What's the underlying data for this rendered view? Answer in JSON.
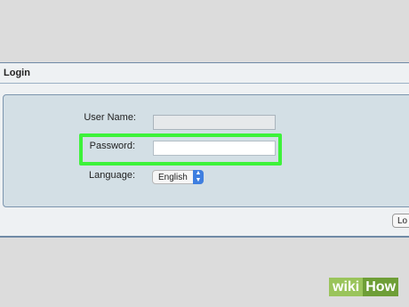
{
  "panel": {
    "title": "Login"
  },
  "form": {
    "username_label": "User Name:",
    "username_value": "",
    "password_label": "Password:",
    "password_value": "",
    "language_label": "Language:",
    "language_value": "English"
  },
  "actions": {
    "login_label": "Lo"
  },
  "watermark": {
    "part1": "wiki",
    "part2": "How"
  },
  "colors": {
    "highlight": "#3df23a",
    "panel_border": "#6f8aa6",
    "select_arrow": "#3f7fe0"
  }
}
